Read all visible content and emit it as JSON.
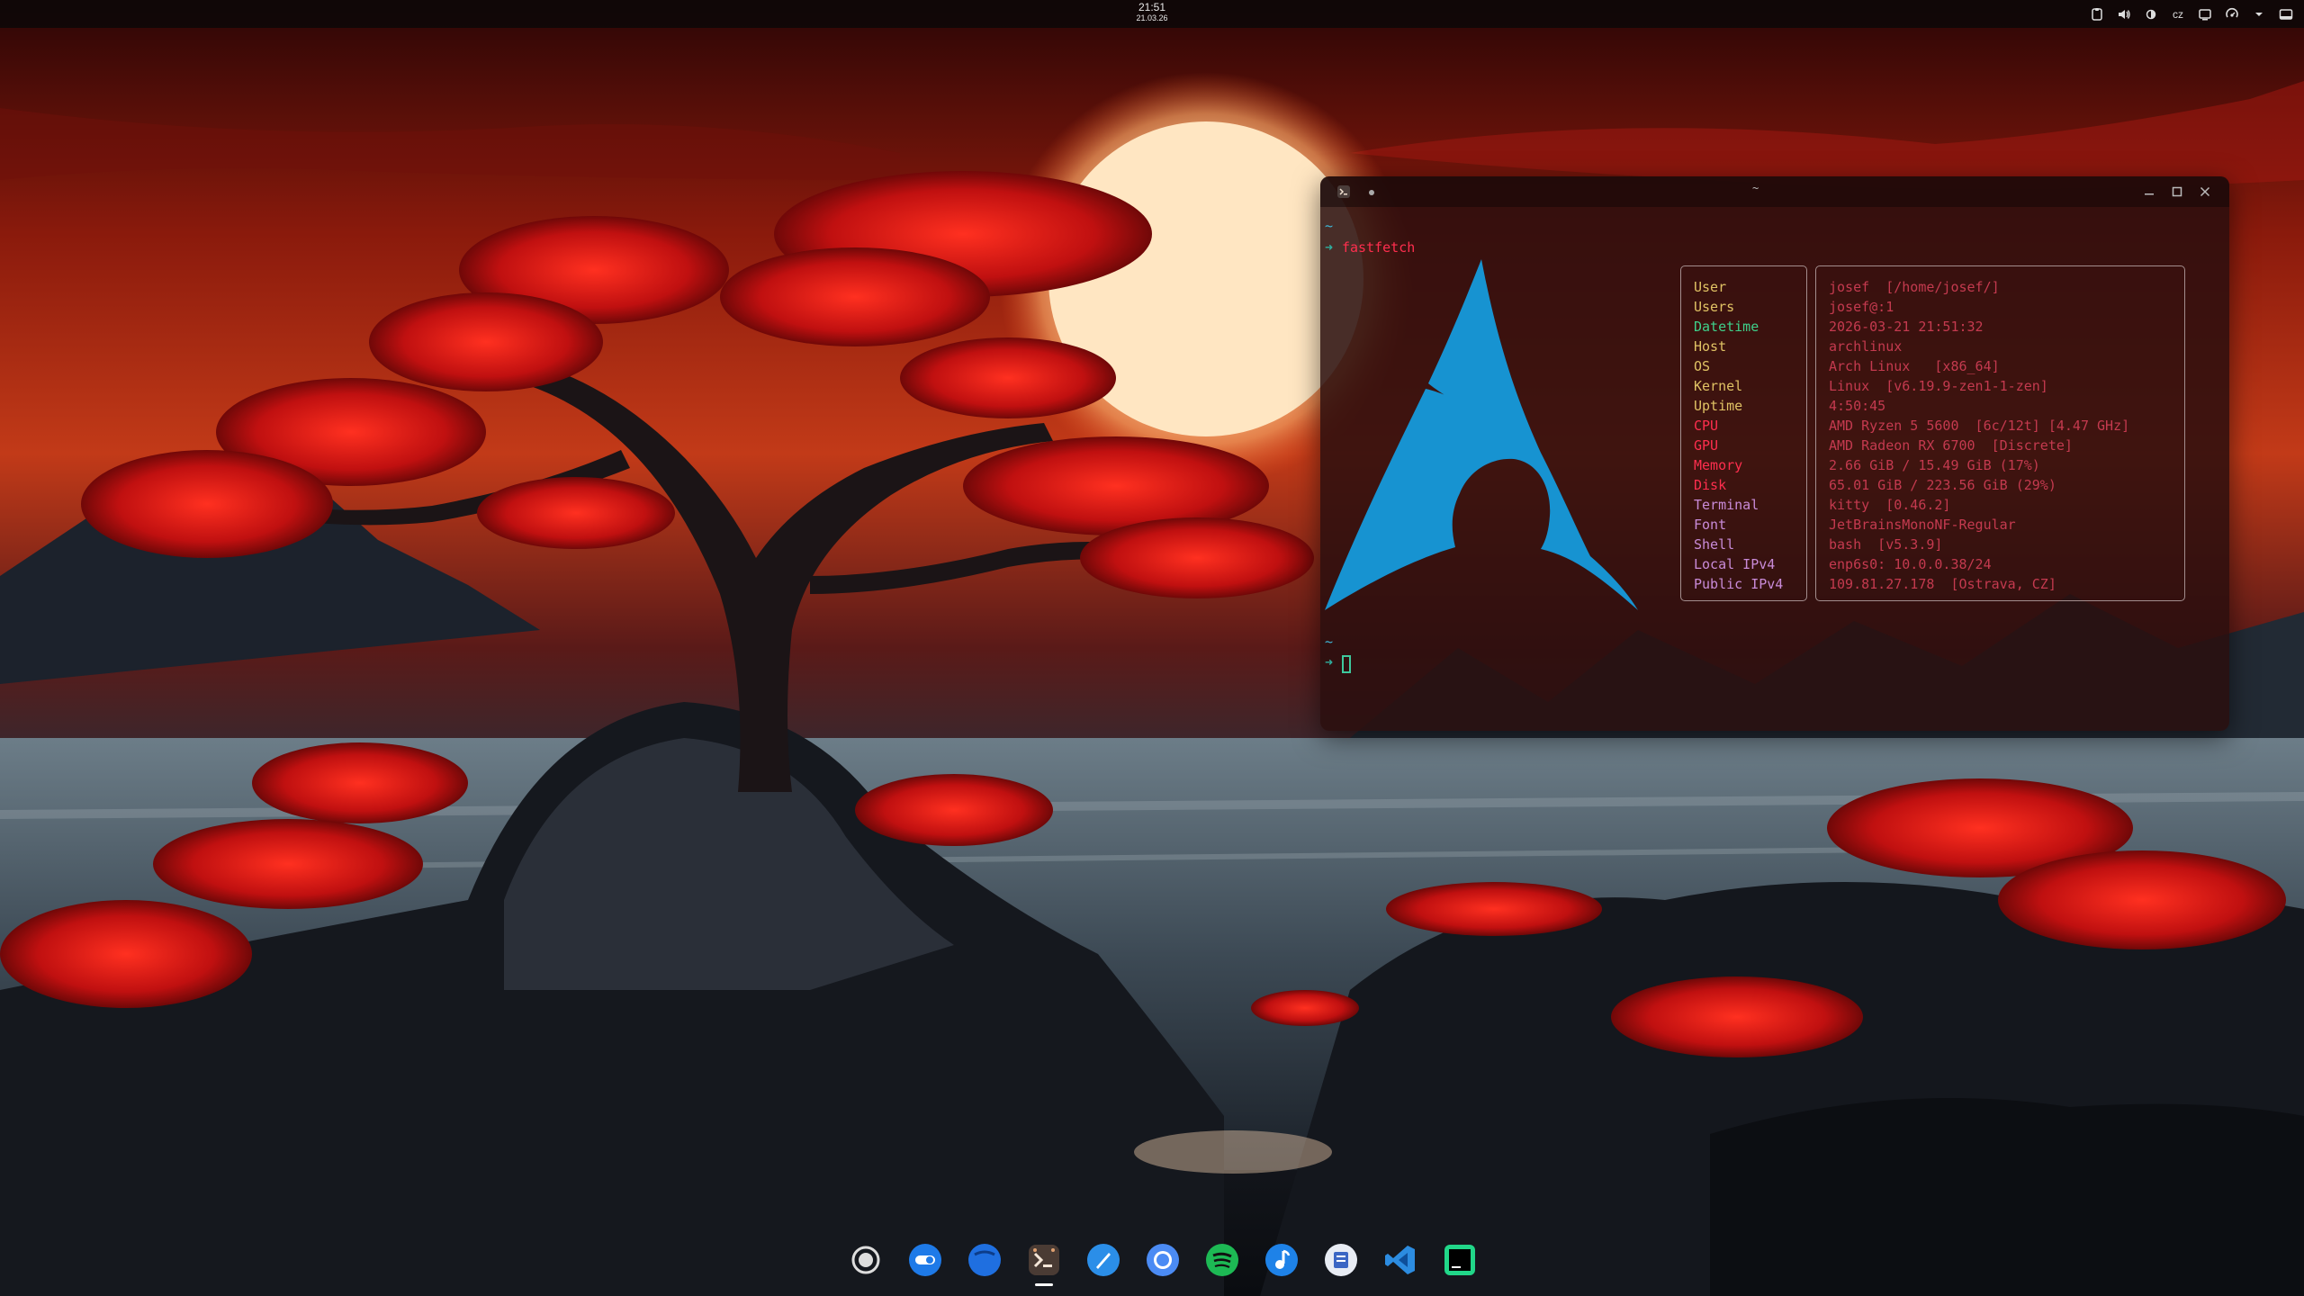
{
  "topbar": {
    "time": "21:51",
    "date": "21.03.26",
    "tray": [
      {
        "icon": "clipboard-icon"
      },
      {
        "icon": "volume-icon"
      },
      {
        "icon": "brightness-icon"
      },
      {
        "icon": "keyboard-layout",
        "label": "cz"
      },
      {
        "icon": "display-icon"
      },
      {
        "icon": "network-icon"
      },
      {
        "icon": "chevron-down-icon"
      },
      {
        "icon": "screen-icon"
      }
    ]
  },
  "terminal": {
    "title": "~",
    "prompt_dir": "~",
    "prompt_arrow": "➜",
    "command": "fastfetch",
    "colors": {
      "accent_red": "#ff2e4e",
      "accent_cyan": "#3fb8d8",
      "arch_blue": "#1793d1",
      "value_text": "#c43a4f"
    },
    "fastfetch": [
      {
        "key": "User",
        "key_color": "#e0c264",
        "value": "josef  [/home/josef/]",
        "value_color": "#c43a4f"
      },
      {
        "key": "Users",
        "key_color": "#e0c264",
        "value": "josef@:1",
        "value_color": "#c43a4f"
      },
      {
        "key": "Datetime",
        "key_color": "#3fd08a",
        "value": "2026-03-21 21:51:32",
        "value_color": "#c43a4f"
      },
      {
        "key": "Host",
        "key_color": "#e0c264",
        "value": "archlinux",
        "value_color": "#c43a4f"
      },
      {
        "key": "OS",
        "key_color": "#e0c264",
        "value": "Arch Linux   [x86_64]",
        "value_color": "#c43a4f"
      },
      {
        "key": "Kernel",
        "key_color": "#e0c264",
        "value": "Linux  [v6.19.9-zen1-1-zen]",
        "value_color": "#c43a4f"
      },
      {
        "key": "Uptime",
        "key_color": "#e0c264",
        "value": "4:50:45",
        "value_color": "#c43a4f"
      },
      {
        "key": "CPU",
        "key_color": "#ff2e4e",
        "value": "AMD Ryzen 5 5600  [6c/12t] [4.47 GHz]",
        "value_color": "#c43a4f"
      },
      {
        "key": "GPU",
        "key_color": "#ff2e4e",
        "value": "AMD Radeon RX 6700  [Discrete]",
        "value_color": "#c43a4f"
      },
      {
        "key": "Memory",
        "key_color": "#ff2e4e",
        "value": "2.66 GiB / 15.49 GiB (17%)",
        "value_color": "#c43a4f"
      },
      {
        "key": "Disk",
        "key_color": "#ff2e4e",
        "value": "65.01 GiB / 223.56 GiB (29%)",
        "value_color": "#c43a4f"
      },
      {
        "key": "Terminal",
        "key_color": "#c98bd8",
        "value": "kitty  [0.46.2]",
        "value_color": "#c43a4f"
      },
      {
        "key": "Font",
        "key_color": "#c98bd8",
        "value": "JetBrainsMonoNF-Regular",
        "value_color": "#c43a4f"
      },
      {
        "key": "Shell",
        "key_color": "#c98bd8",
        "value": "bash  [v5.3.9]",
        "value_color": "#c43a4f"
      },
      {
        "key": "Local IPv4",
        "key_color": "#c98bd8",
        "value": "enp6s0: 10.0.0.38/24",
        "value_color": "#c43a4f"
      },
      {
        "key": "Public IPv4",
        "key_color": "#c98bd8",
        "value": "109.81.27.178  [Ostrava, CZ]",
        "value_color": "#c43a4f"
      }
    ]
  },
  "dock": {
    "apps": [
      {
        "name": "activities",
        "icon": "activities-icon"
      },
      {
        "name": "toggle",
        "icon": "toggle-app-icon"
      },
      {
        "name": "files",
        "icon": "files-icon"
      },
      {
        "name": "terminal",
        "icon": "terminal-icon",
        "running": true
      },
      {
        "name": "browser",
        "icon": "browser-icon"
      },
      {
        "name": "chromium",
        "icon": "chromium-icon"
      },
      {
        "name": "spotify",
        "icon": "spotify-icon"
      },
      {
        "name": "music",
        "icon": "music-icon"
      },
      {
        "name": "notes",
        "icon": "notes-icon"
      },
      {
        "name": "vscode",
        "icon": "vscode-icon"
      },
      {
        "name": "pycharm",
        "icon": "pycharm-icon"
      }
    ]
  }
}
